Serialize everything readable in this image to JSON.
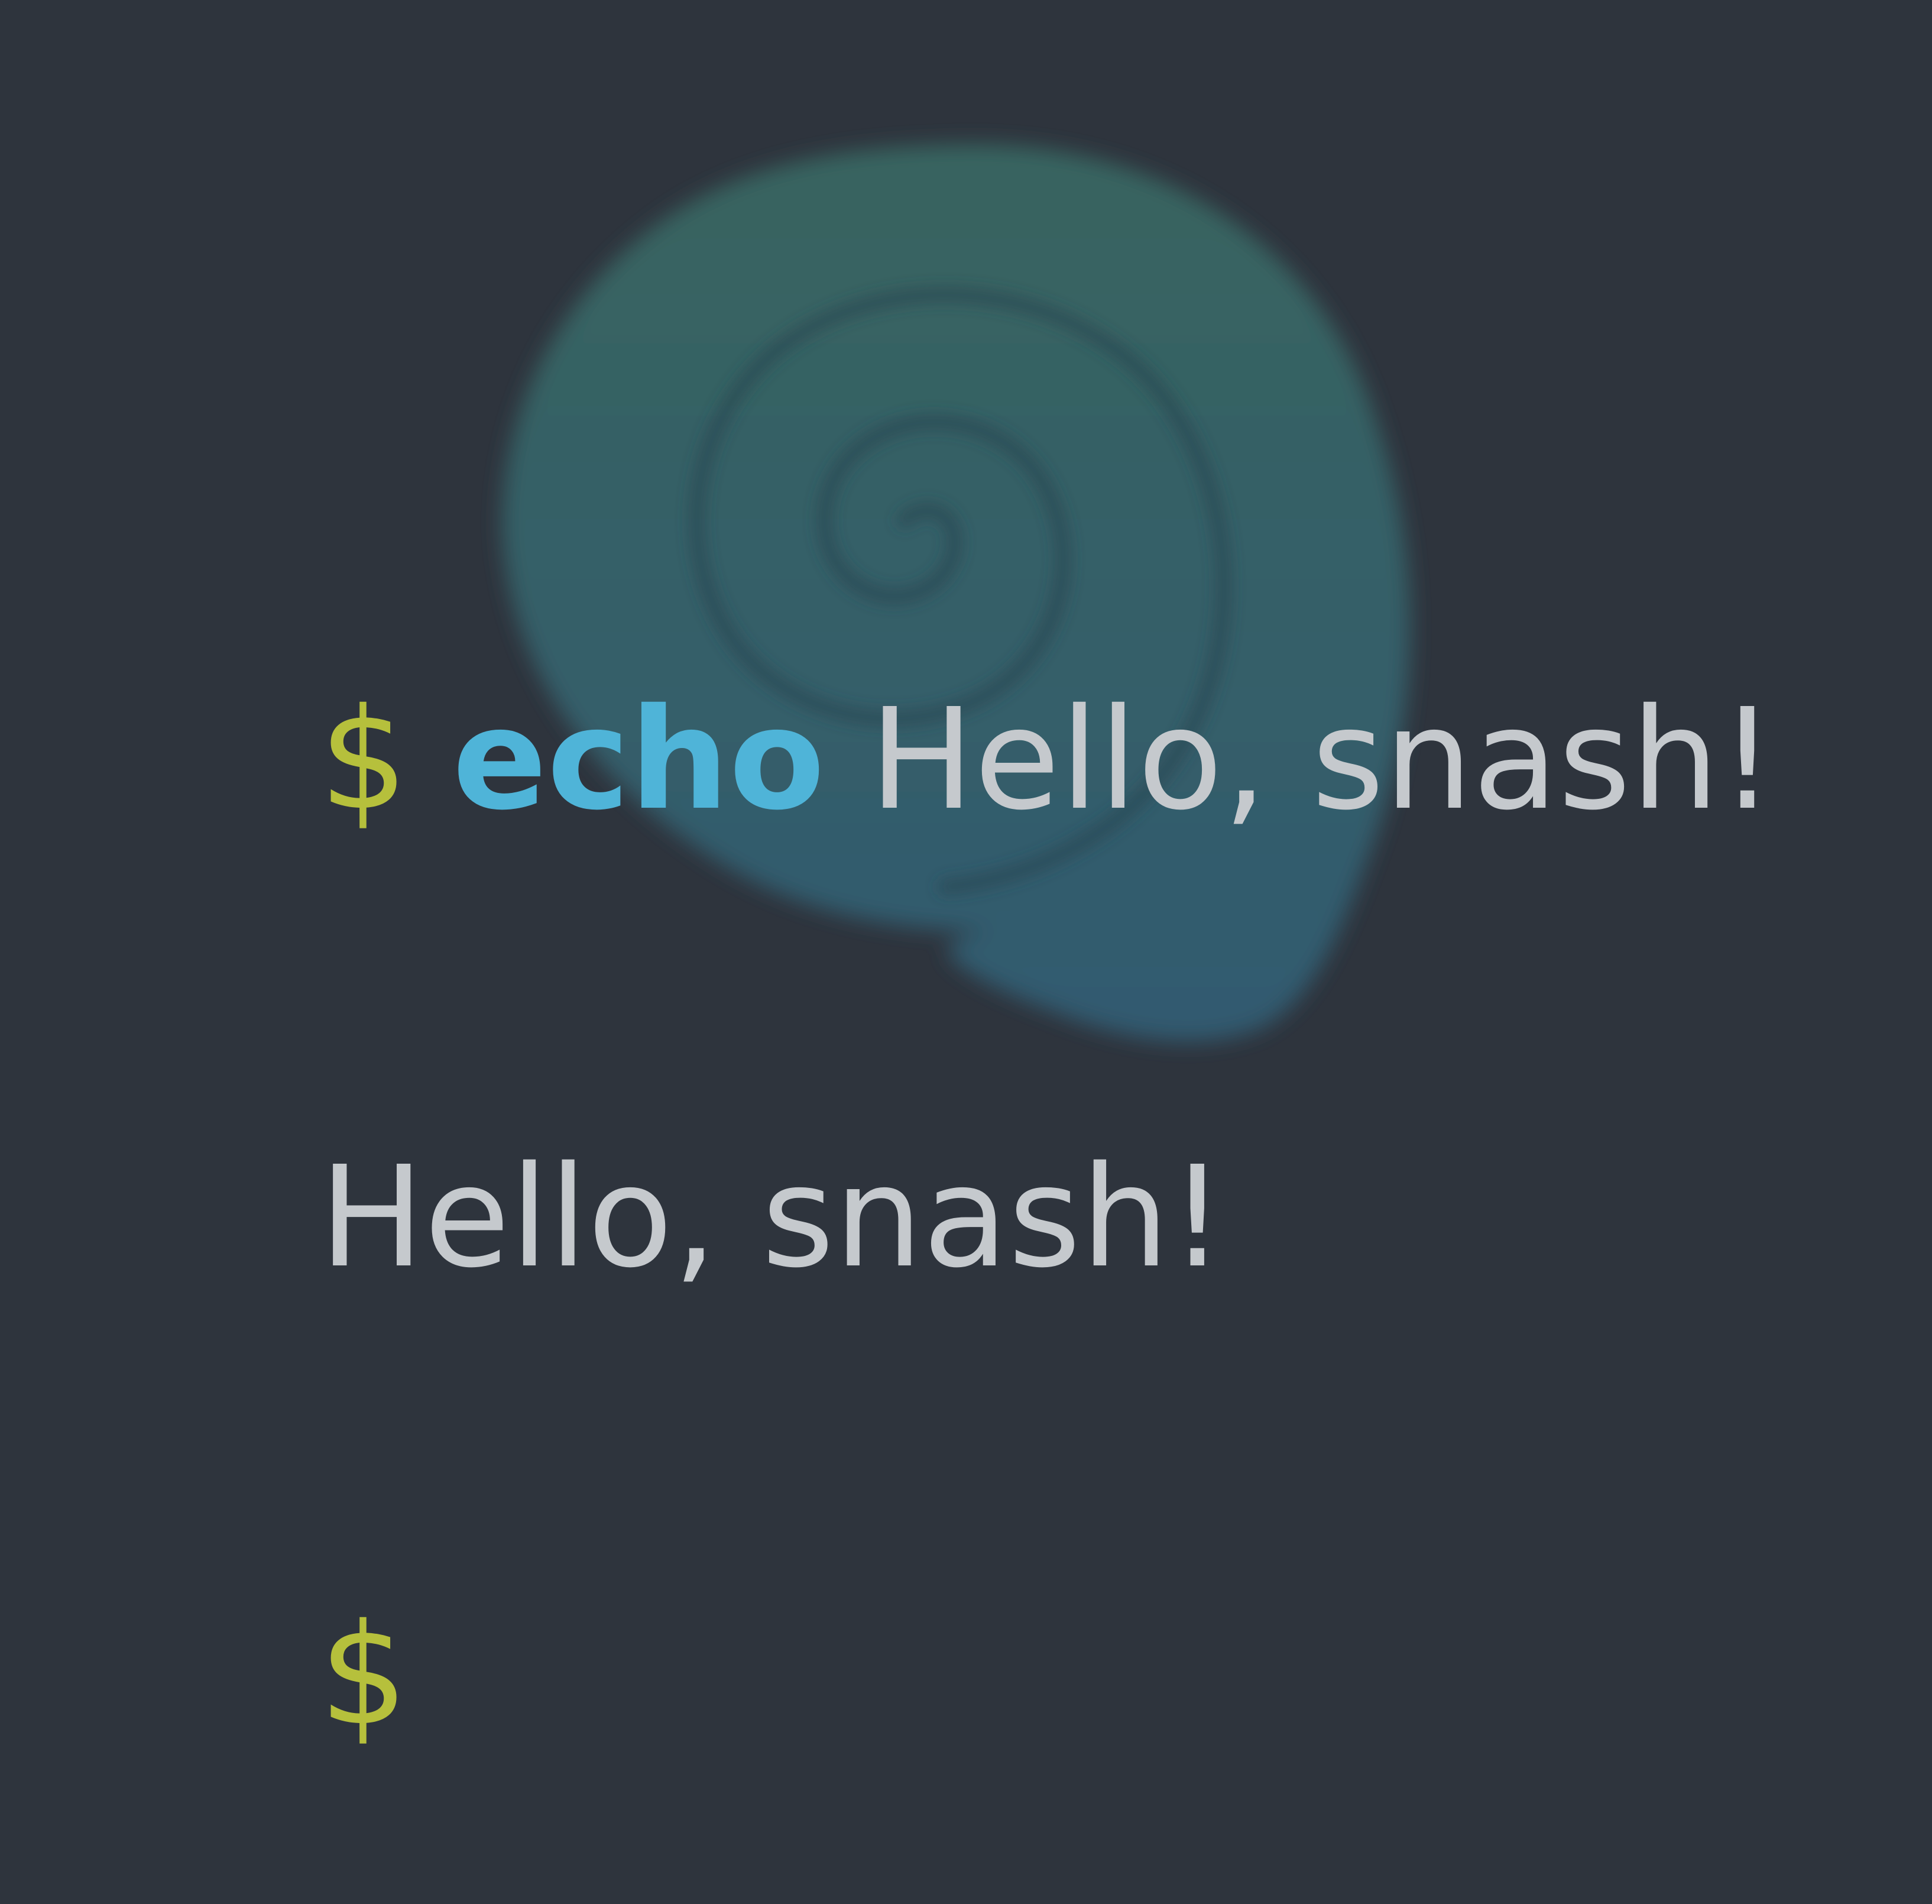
{
  "colors": {
    "background": "#2e343d",
    "prompt": "#b6c03c",
    "command": "#4fb4d8",
    "text": "#c5c9cd",
    "shell_logo_top": "#386560",
    "shell_logo_bottom": "#325a70"
  },
  "logo": {
    "icon": "spiral-shell-logo-icon"
  },
  "terminal": {
    "lines": [
      {
        "prompt": "$",
        "command": "echo",
        "args": "Hello, snash!"
      },
      {
        "output": "Hello, snash!"
      },
      {
        "prompt": "$"
      }
    ]
  }
}
